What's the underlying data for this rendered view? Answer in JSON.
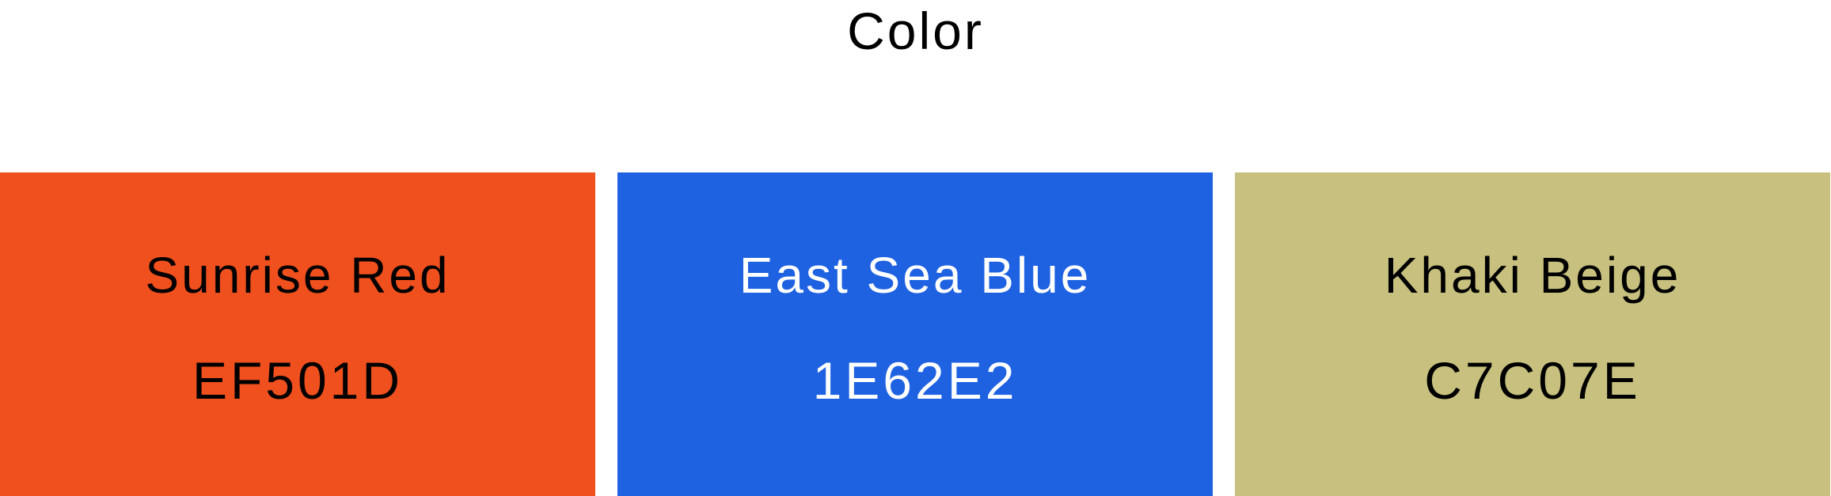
{
  "heading": "Color",
  "swatches": [
    {
      "name": "Sunrise Red",
      "hex": "EF501D",
      "color": "#EF501D",
      "text_color": "#000000"
    },
    {
      "name": "East Sea Blue",
      "hex": "1E62E2",
      "color": "#1E62E2",
      "text_color": "#FFFFFF"
    },
    {
      "name": "Khaki Beige",
      "hex": "C7C07E",
      "color": "#C7C07E",
      "text_color": "#000000"
    }
  ]
}
